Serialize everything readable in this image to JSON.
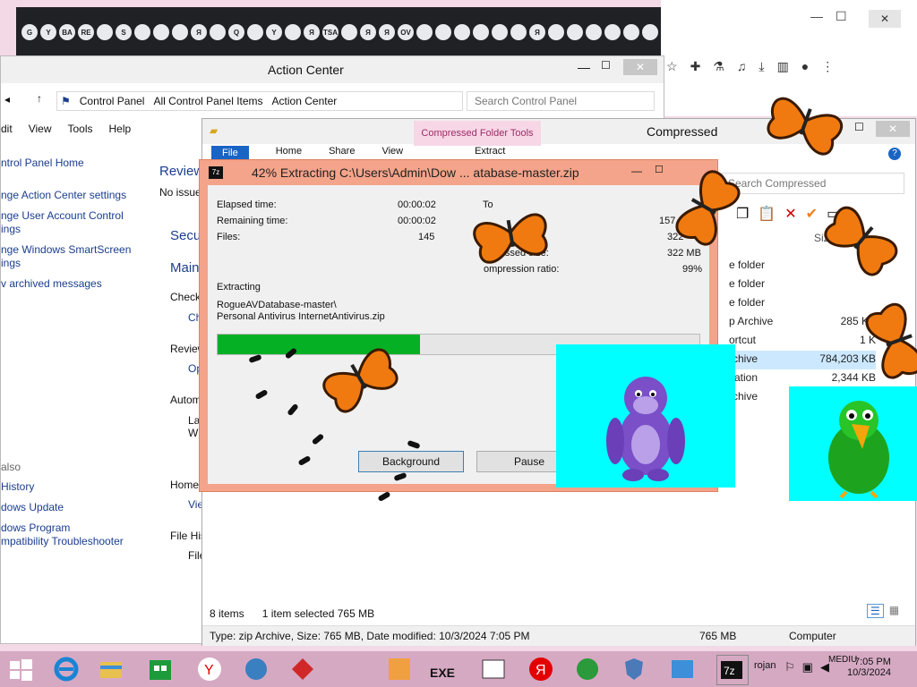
{
  "chrome": {
    "tabs": [
      "G",
      "Y",
      "BA",
      "RE",
      "",
      "S",
      "",
      "",
      "",
      "Я",
      "",
      "Q",
      "",
      "Y",
      "",
      "Я",
      "TSA",
      "",
      "Я",
      "Я",
      "OV",
      "",
      "",
      "",
      "",
      "",
      "",
      "Я",
      "",
      "",
      "",
      "",
      "",
      ""
    ],
    "close_glyph": "✕",
    "new_tab_glyph": "+"
  },
  "action_center": {
    "title": "Action Center",
    "breadcrumbs": [
      "Control Panel",
      "All Control Panel Items",
      "Action Center"
    ],
    "search_placeholder": "Search Control Panel",
    "menu": [
      "dit",
      "View",
      "Tools",
      "Help"
    ],
    "left_links": [
      "ntrol Panel Home",
      "nge Action Center settings",
      "nge User Account Control",
      "ings",
      "nge Windows SmartScreen",
      "ings",
      "v archived messages"
    ],
    "main_items": [
      "Review",
      "No issue",
      "Secu",
      "Main",
      "Check",
      "Ch",
      "Review",
      "Op",
      "Autom",
      "La",
      "Wi",
      "Home",
      "Vie",
      "File His",
      "File"
    ],
    "see_also": "also",
    "see_also_links": [
      "History",
      "dows Update",
      "dows Program",
      "mpatibility Troubleshooter"
    ]
  },
  "compressed": {
    "title": "Compressed",
    "tool_tab": "Compressed Folder Tools",
    "ribbon": [
      "File",
      "Home",
      "Share",
      "View",
      "Extract"
    ],
    "search_placeholder": "Search Compressed",
    "size_header": "Size",
    "rows": [
      {
        "type": "e folder",
        "size": ""
      },
      {
        "type": "e folder",
        "size": ""
      },
      {
        "type": "e folder",
        "size": ""
      },
      {
        "type": "p Archive",
        "size": "285 KB"
      },
      {
        "type": "ortcut",
        "size": "1 K"
      },
      {
        "type": "rchive",
        "size": "784,203 KB"
      },
      {
        "type": "cation",
        "size": "2,344 KB"
      },
      {
        "type": "rchive",
        "size": ""
      }
    ],
    "status_items": "8 items",
    "status_selected": "1 item selected  765 MB",
    "bottom_info": "Type: zip Archive, Size: 765 MB, Date modified: 10/3/2024 7:05 PM",
    "bottom_size": "765 MB",
    "bottom_location": "Computer"
  },
  "extract_dialog": {
    "icon_label": "7z",
    "title": "42% Extracting C:\\Users\\Admin\\Dow ... atabase-master.zip",
    "elapsed_label": "Elapsed time:",
    "elapsed_value": "00:00:02",
    "remaining_label": "Remaining time:",
    "remaining_value": "00:00:02",
    "files_label": "Files:",
    "files_value": "145",
    "total_label": "To",
    "total_value": "157",
    "processed_label": "ssed",
    "processed_value": "322",
    "compressed_label": "pressed size:",
    "compressed_value": "322 MB",
    "ratio_label": "ompression ratio:",
    "ratio_value": "99%",
    "extracting_label": "Extracting",
    "path_line1": "RogueAVDatabase-master\\",
    "path_line2": "Personal Antivirus InternetAntivirus.zip",
    "progress": 0.42,
    "background_button": "Background",
    "pause_button": "Pause"
  },
  "taskbar": {
    "clock_time": "7:05 PM",
    "clock_date": "10/3/2024",
    "exe_label": "EXE",
    "tray_text": "MEDIU",
    "trojan_text": "rojan"
  },
  "colors": {
    "progress_fill": "#06b025",
    "dialog_frame": "#f4a48a",
    "cyan_panel": "#00ffff",
    "taskbar": "#d6a9c3"
  }
}
